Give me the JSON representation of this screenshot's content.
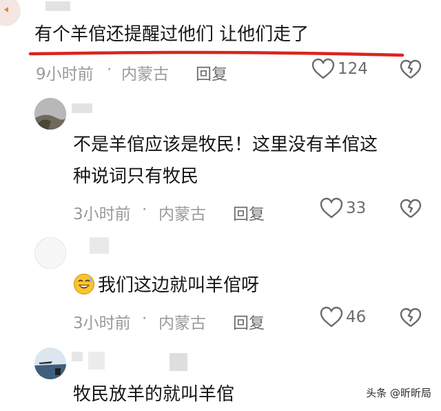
{
  "comments": [
    {
      "text": "有个羊倌还提醒过他们 让他们走了",
      "time": "9小时前",
      "sep": "·",
      "location": "内蒙古",
      "reply": "回复",
      "likes": "124"
    },
    {
      "lines": [
        "不是羊倌应该是牧民！这里没有羊倌这",
        "种说词只有牧民"
      ],
      "time": "3小时前",
      "sep": "·",
      "location": "内蒙古",
      "reply": "回复",
      "likes": "33"
    },
    {
      "text": "我们这边就叫羊倌呀",
      "emoji": "laughing-sweat-emoji",
      "time": "3小时前",
      "sep": "·",
      "location": "内蒙古",
      "reply": "回复",
      "likes": "46"
    },
    {
      "text": "牧民放羊的就叫羊倌"
    }
  ],
  "watermark": "头条 @昕昕局",
  "colors": {
    "underline": "#d9251d",
    "meta": "#9a9a9a",
    "text": "#161616"
  },
  "icons": [
    "heart-icon",
    "broken-heart-icon"
  ]
}
